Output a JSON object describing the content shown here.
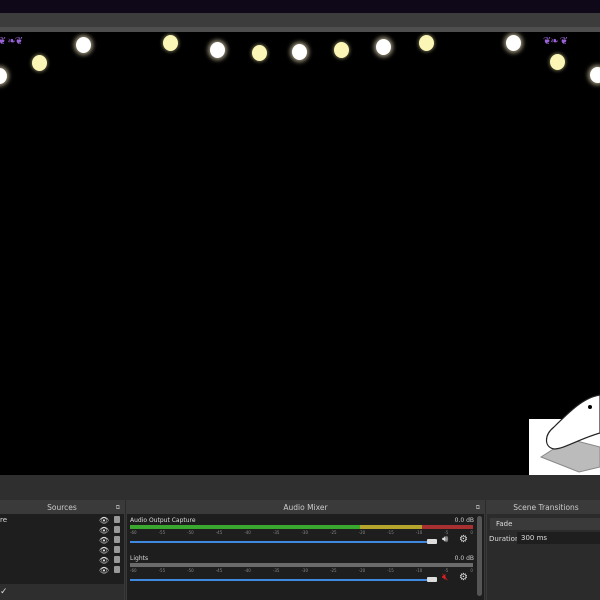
{
  "sources": {
    "title": "Sources",
    "items": [
      {
        "name": "re"
      },
      {
        "name": ""
      },
      {
        "name": ""
      },
      {
        "name": ""
      },
      {
        "name": ""
      },
      {
        "name": ""
      }
    ],
    "check": "✓"
  },
  "mixer": {
    "title": "Audio Mixer",
    "channels": [
      {
        "name": "Audio Output Capture",
        "db": "0.0 dB",
        "muted": false,
        "volume": 0.97
      },
      {
        "name": "Lights",
        "db": "0.0 dB",
        "muted": true,
        "volume": 0.97
      }
    ],
    "ticks": [
      "-60",
      "-55",
      "-50",
      "-45",
      "-40",
      "-35",
      "-30",
      "-25",
      "-20",
      "-15",
      "-10",
      "-5",
      "0"
    ]
  },
  "transitions": {
    "title": "Scene Transitions",
    "selected": "Fade",
    "duration_label": "Duration",
    "duration": "300 ms"
  },
  "colors": {
    "meter_green": "#3aa82e",
    "meter_yellow": "#b5a52c",
    "meter_red": "#a83030",
    "slider": "#3f8ae0",
    "mute": "#e02020"
  }
}
